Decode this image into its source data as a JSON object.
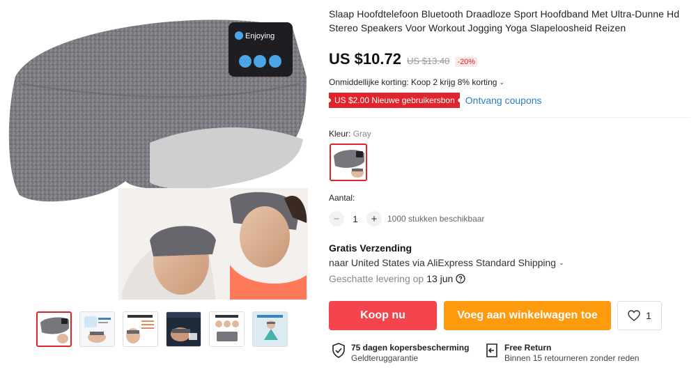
{
  "product": {
    "title": "Slaap Hoofdtelefoon Bluetooth Draadloze Sport Hoofdband Met Ultra-Dunne Hd Stereo Speakers Voor Workout Jogging Yoga Slapeloosheid Reizen",
    "headband_label": "Enjoying",
    "price": "US $10.72",
    "old_price": "US $13.40",
    "discount": "-20%",
    "promo": "Onmiddellijke korting: Koop 2 krijg 8% korting",
    "coupon_badge": "US $2.00 Nieuwe gebruikersbon",
    "coupon_link": "Ontvang coupons",
    "color_label": "Kleur:",
    "color_value": "Gray",
    "quantity_label": "Aantal:",
    "quantity": "1",
    "minus": "−",
    "plus": "+",
    "availability": "1000 stukken beschikbaar"
  },
  "shipping": {
    "title": "Gratis Verzending",
    "line": "naar United States via AliExpress Standard Shipping",
    "delivery_label": "Geschatte levering op",
    "delivery_date": "13 jun"
  },
  "actions": {
    "buy_now": "Koop nu",
    "add_to_cart": "Voeg aan winkelwagen toe",
    "wishlist_count": "1"
  },
  "guarantees": [
    {
      "title": "75 dagen kopersbescherming",
      "subtitle": "Geldteruggarantie",
      "icon": "shield-check-icon"
    },
    {
      "title": "Free Return",
      "subtitle": "Binnen 15 retourneren zonder reden",
      "icon": "return-box-icon"
    }
  ],
  "thumbnails": [
    {
      "name": "headband-gray"
    },
    {
      "name": "sleeping-man-features"
    },
    {
      "name": "feature-list-sleeper"
    },
    {
      "name": "dark-sleeping-mask"
    },
    {
      "name": "one-size-fits-all"
    },
    {
      "name": "yoga-wearing"
    }
  ],
  "colors": {
    "accent": "#e0242b",
    "buy": "#f4454e",
    "cart": "#fd9a0e",
    "link": "#2a7fc2"
  }
}
